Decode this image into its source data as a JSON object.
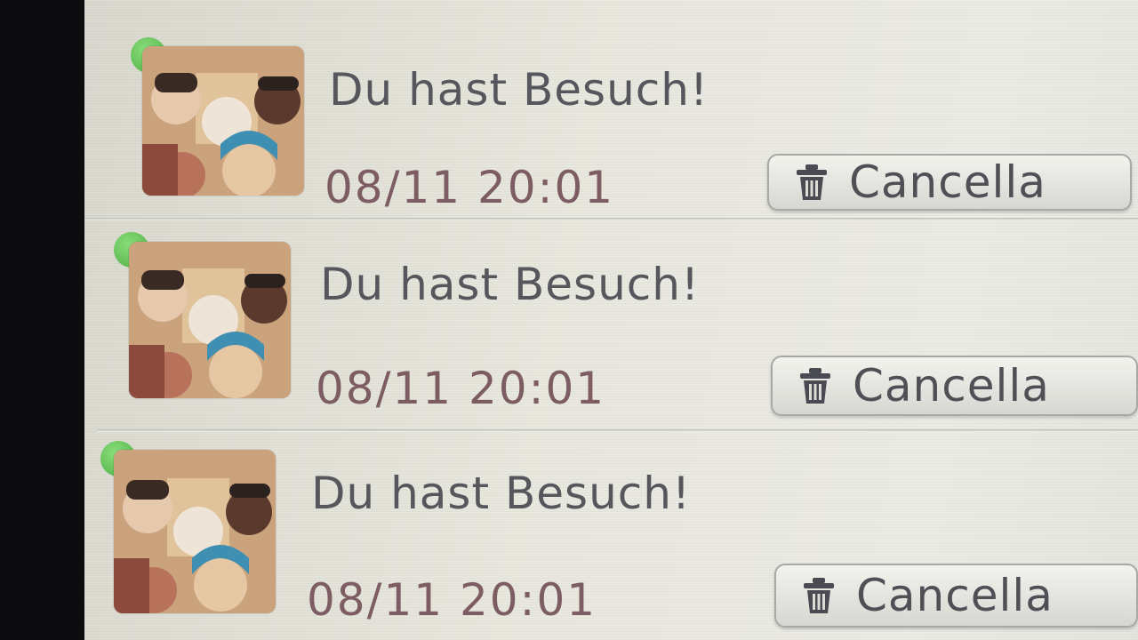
{
  "notifications": [
    {
      "title": "Du hast Besuch!",
      "timestamp": "08/11 20:01",
      "delete_label": "Cancella",
      "unread": true
    },
    {
      "title": "Du hast Besuch!",
      "timestamp": "08/11 20:01",
      "delete_label": "Cancella",
      "unread": true
    },
    {
      "title": "Du hast Besuch!",
      "timestamp": "08/11 20:01",
      "delete_label": "Cancella",
      "unread": true
    }
  ],
  "colors": {
    "unread_dot": "#5cc04f",
    "title_text": "#56565c",
    "timestamp_text": "#7d5d63",
    "button_text": "#4f4f56"
  },
  "icons": {
    "delete": "trash-icon",
    "status": "unread-dot"
  }
}
